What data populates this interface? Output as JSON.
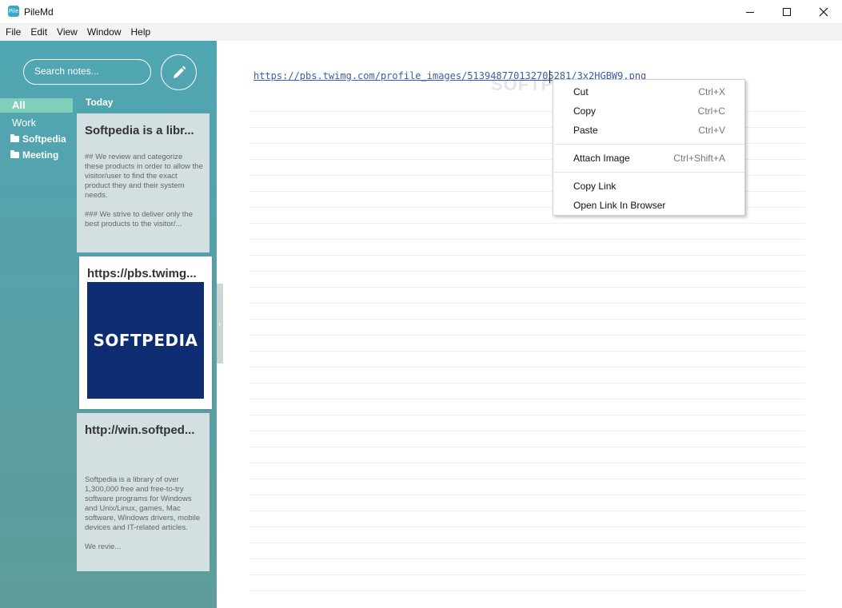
{
  "window": {
    "app_icon_text": "Pile",
    "title": "PileMd"
  },
  "menubar": [
    "File",
    "Edit",
    "View",
    "Window",
    "Help"
  ],
  "sidebar": {
    "search_placeholder": "Search notes...",
    "nav": {
      "all": "All",
      "work": "Work",
      "folders": [
        "Softpedia",
        "Meeting"
      ]
    },
    "section_label": "Today",
    "notes": [
      {
        "title": "Softpedia is a libr...",
        "excerpt": "## We review and categorize these products in order to allow the visitor/user to find the exact product they and their system needs.\n\n### We strive to deliver only the best products to the visitor/..."
      },
      {
        "title": "https://pbs.twimg...",
        "image_text": "SOFTPEDIA"
      },
      {
        "title": "http://win.softped...",
        "excerpt": "Softpedia is a library of over 1,300,000 free and free-to-try software programs for Windows and Unix/Linux, games, Mac software, Windows drivers, mobile devices and IT-related articles.\n\nWe revie..."
      }
    ]
  },
  "editor": {
    "content_url": "https://pbs.twimg.com/profile_images/513948770132705281/3x2HGBW9.png",
    "watermark": "SOFTPEDIA"
  },
  "context_menu": {
    "items": [
      {
        "label": "Cut",
        "shortcut": "Ctrl+X"
      },
      {
        "label": "Copy",
        "shortcut": "Ctrl+C"
      },
      {
        "label": "Paste",
        "shortcut": "Ctrl+V"
      },
      {
        "label": "Attach Image",
        "shortcut": "Ctrl+Shift+A"
      },
      {
        "label": "Copy Link",
        "shortcut": ""
      },
      {
        "label": "Open Link In Browser",
        "shortcut": ""
      }
    ]
  },
  "colors": {
    "sidebar": "#55a3ad",
    "nav_active": "#7fcfbb",
    "note_bg": "#d3dfe0",
    "thumb_bg": "#0e2c72",
    "link": "#3b5fa8"
  }
}
